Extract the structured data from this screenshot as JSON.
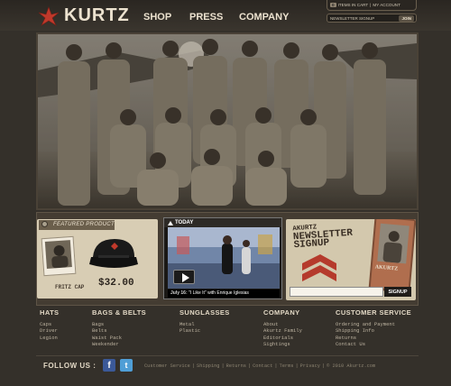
{
  "brand": {
    "name": "KURTZ"
  },
  "nav": {
    "items": [
      {
        "label": "SHOP"
      },
      {
        "label": "PRESS"
      },
      {
        "label": "COMPANY"
      }
    ]
  },
  "utility": {
    "cart_count": "0",
    "cart_label": "ITEMS IN CART",
    "separator": "|",
    "account_label": "MY ACCOUNT"
  },
  "newsletter_bar": {
    "placeholder": "NEWSLETTER SIGNUP",
    "join_label": "JOIN"
  },
  "featured": {
    "tag": "FEATURED PRODUCT",
    "product_name": "FRITZ CAP",
    "price": "$32.00"
  },
  "today": {
    "label": "TODAY",
    "caption_date": "July 16:",
    "caption_text": "\"I Like It\" with Enrique Iglesias"
  },
  "newsletter": {
    "title_line1": "AKURTZ",
    "title_line2": "NEWSLETTER",
    "title_line3": "SIGNUP",
    "tag_brand": "AKURTZ",
    "signup_label": "SIGNUP"
  },
  "footer": {
    "columns": [
      {
        "heading": "HATS",
        "links": [
          "Caps",
          "Driver",
          "Legion"
        ]
      },
      {
        "heading": "BAGS & BELTS",
        "links": [
          "Bags",
          "Belts",
          "Waist Pack",
          "Weekender"
        ]
      },
      {
        "heading": "SUNGLASSES",
        "links": [
          "Metal",
          "Plastic"
        ]
      },
      {
        "heading": "COMPANY",
        "links": [
          "About",
          "Akurtz Family",
          "Editorials",
          "Sightings"
        ]
      },
      {
        "heading": "CUSTOMER SERVICE",
        "links": [
          "Ordering and Payment",
          "Shipping Info",
          "Returns",
          "Contact Us"
        ]
      }
    ],
    "follow_label": "FOLLOW US :",
    "social": {
      "facebook": "f",
      "twitter": "t"
    },
    "links": [
      "Customer Service",
      "Shipping",
      "Returns",
      "Contact",
      "Terms",
      "Privacy"
    ],
    "link_separator": "|",
    "copyright": "© 2010 Akurtz.com"
  },
  "colors": {
    "background": "#34302a",
    "accent_red": "#c0392b",
    "paper": "#d8cdb4"
  }
}
